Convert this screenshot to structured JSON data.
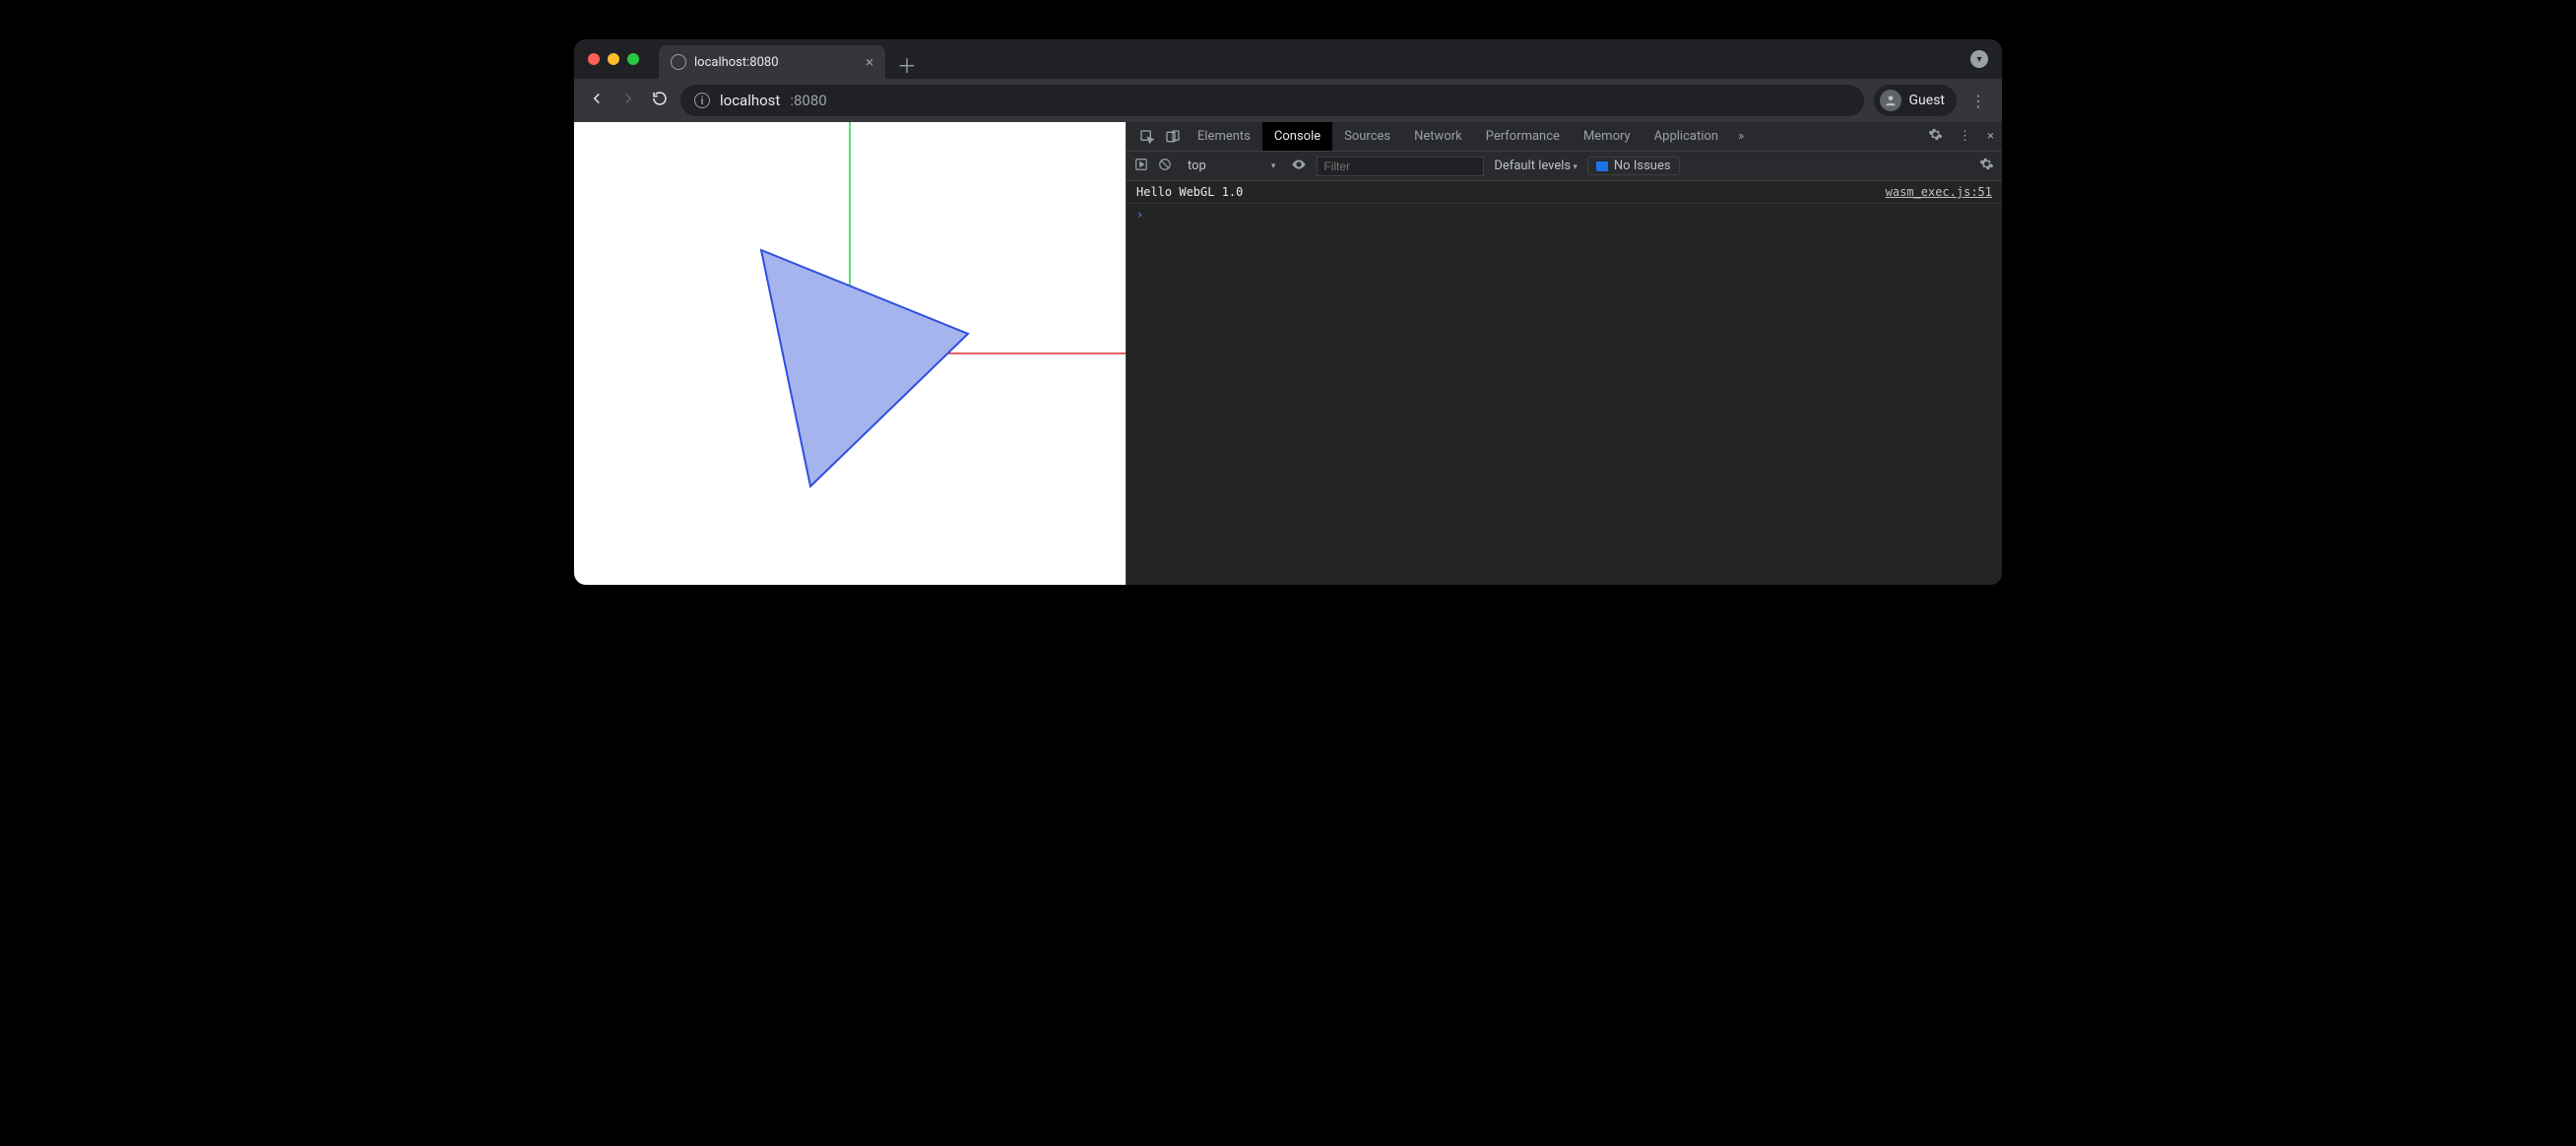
{
  "tab": {
    "title": "localhost:8080"
  },
  "url": {
    "host": "localhost",
    "port": ":8080"
  },
  "guest_label": "Guest",
  "devtools": {
    "tabs": [
      "Elements",
      "Console",
      "Sources",
      "Network",
      "Performance",
      "Memory",
      "Application"
    ],
    "active_tab": "Console",
    "context": "top",
    "filter_placeholder": "Filter",
    "levels_label": "Default levels",
    "issues_label": "No Issues",
    "log": {
      "message": "Hello WebGL 1.0",
      "source": "wasm_exec.js:51"
    }
  },
  "canvas": {
    "triangle_fill": "#a6b4ee",
    "triangle_stroke": "#2f4fe0",
    "x_axis_color": "#e03030",
    "y_axis_color": "#2bd24a"
  }
}
